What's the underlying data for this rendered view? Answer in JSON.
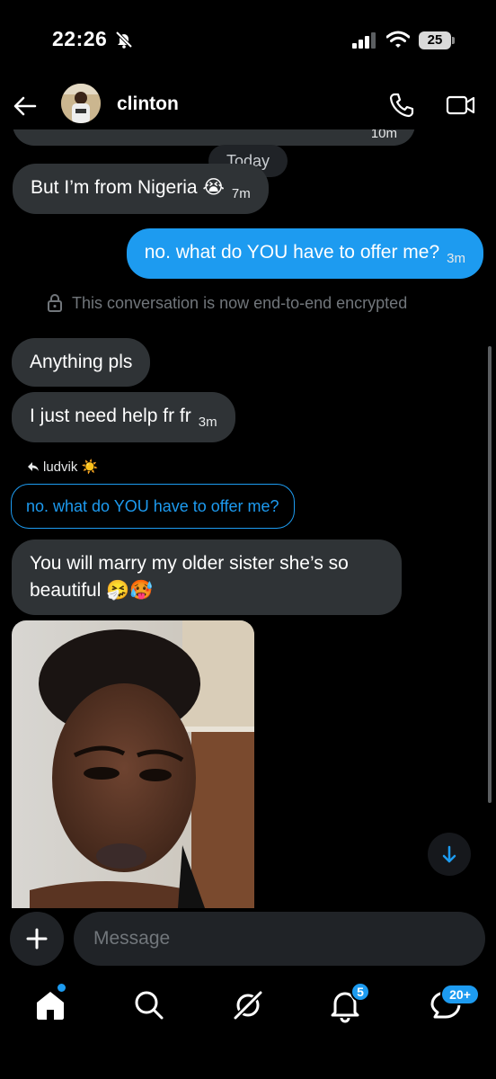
{
  "status_bar": {
    "time": "22:26",
    "battery": "25",
    "icons": [
      "bell-slash-icon",
      "signal-icon",
      "wifi-icon",
      "battery-icon"
    ]
  },
  "header": {
    "contact_name": "clinton",
    "icons": [
      "back-arrow-icon",
      "phone-icon",
      "video-icon"
    ]
  },
  "messages": {
    "partial_ts": "10m",
    "today": "Today",
    "m1": {
      "text": "But I’m from Nigeria 😭",
      "ts": "7m"
    },
    "m2": {
      "text": "no. what do YOU have to offer me?",
      "ts": "3m"
    },
    "encrypted_notice": "This conversation is now end-to-end encrypted",
    "m3": {
      "text": "Anything pls"
    },
    "m4": {
      "text": "I just need help fr fr",
      "ts": "3m"
    },
    "reply_to": "ludvik ☀️",
    "quoted": "no. what do YOU have to offer me?",
    "m5_line1": "You will marry my older sister she’s so",
    "m5_line2": "beautiful 🤧🥵"
  },
  "composer": {
    "placeholder": "Message"
  },
  "nav": {
    "notifications_badge": "5",
    "messages_badge": "20+"
  },
  "colors": {
    "background": "#000000",
    "incoming_bubble": "#2f3336",
    "outgoing_bubble": "#1d9bf0",
    "muted_text": "#71767b",
    "accent": "#1d9bf0"
  }
}
